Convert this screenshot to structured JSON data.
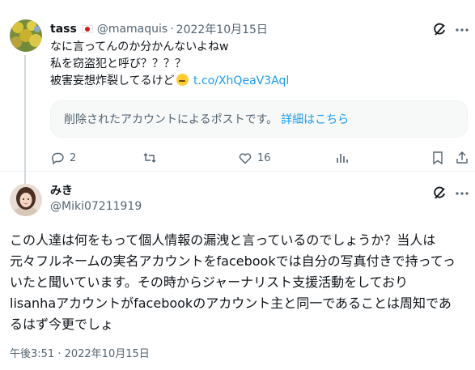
{
  "tweet_parent": {
    "display_name": "tass",
    "handle": "@mamaquis",
    "separator": "·",
    "date": "2022年10月15日",
    "lines": [
      "なに言ってんのか分かんないよねw",
      "私を窃盗犯と呼び？？？？",
      "被害妄想炸裂してるけど"
    ],
    "link": "t.co/XhQeaV3Aql",
    "quoted": {
      "text": "削除されたアカウントによるポストです。",
      "link": "詳細はこちら"
    },
    "actions": {
      "replies": "2",
      "retweets": "",
      "likes": "16"
    }
  },
  "tweet_reply": {
    "display_name": "みき",
    "handle": "@Miki07211919",
    "lines": [
      "この人達は何をもって個人情報の漏洩と言っているのでしょうか？当人は",
      "元々フルネームの実名アカウントをfacebookでは自分の写真付きで持ってっ",
      "いたと聞いています。その時からジャーナリスト支援活動をしており",
      "lisanhaアカウントがfacebookのアカウント主と同一であることは周知であ",
      "るはず今更でしょ"
    ],
    "timestamp": "午後3:51 · 2022年10月15日"
  },
  "icons": {
    "grok": "grok-icon",
    "more": "more-icon",
    "reply": "reply-icon",
    "retweet": "retweet-icon",
    "like": "like-icon",
    "views": "views-icon",
    "bookmark": "bookmark-icon",
    "share": "share-icon"
  },
  "colors": {
    "link": "#1d9bf0",
    "secondary_text": "#536471",
    "primary_text": "#0f1419"
  }
}
